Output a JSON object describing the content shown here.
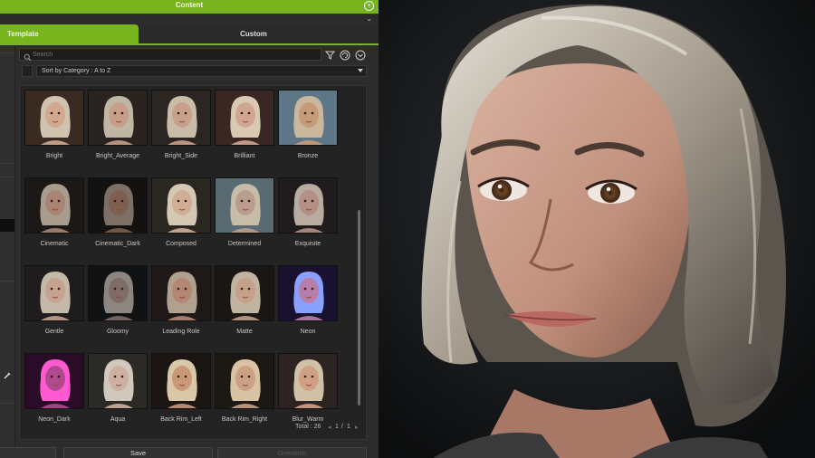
{
  "panel": {
    "title": "Content",
    "tabs": {
      "template": "Template",
      "custom": "Custom"
    },
    "search": {
      "placeholder": "Search"
    },
    "sort": {
      "label": "Sort by Category : A to Z"
    },
    "templates": [
      "Bright",
      "Bright_Average",
      "Bright_Side",
      "Brilliant",
      "Bronze",
      "Cinematic",
      "Cinematic_Dark",
      "Composed",
      "Determined",
      "Exquisite",
      "Gentle",
      "Gloomy",
      "Leading Role",
      "Matte",
      "Neon",
      "Neon_Dark",
      "Aqua",
      "Back Rim_Left",
      "Back Rim_Right",
      "Blur_Warm"
    ],
    "pagination": {
      "total_label": "Total : 26",
      "current_page": "1",
      "separator": "/",
      "total_pages": "1"
    },
    "buttons": {
      "save": "Save",
      "overwrite": "Overwrite"
    }
  },
  "colors": {
    "accent": "#78b41e",
    "panel_bg": "#2c2c2c",
    "grid_bg": "#232323",
    "preview_bg": "#1a1c1d"
  },
  "icons": {
    "close": "close-circle-icon",
    "collapse": "double-chevron-down-icon",
    "search": "search-icon",
    "filter": "filter-icon",
    "refresh": "refresh-icon",
    "more": "chevron-circle-icon"
  }
}
